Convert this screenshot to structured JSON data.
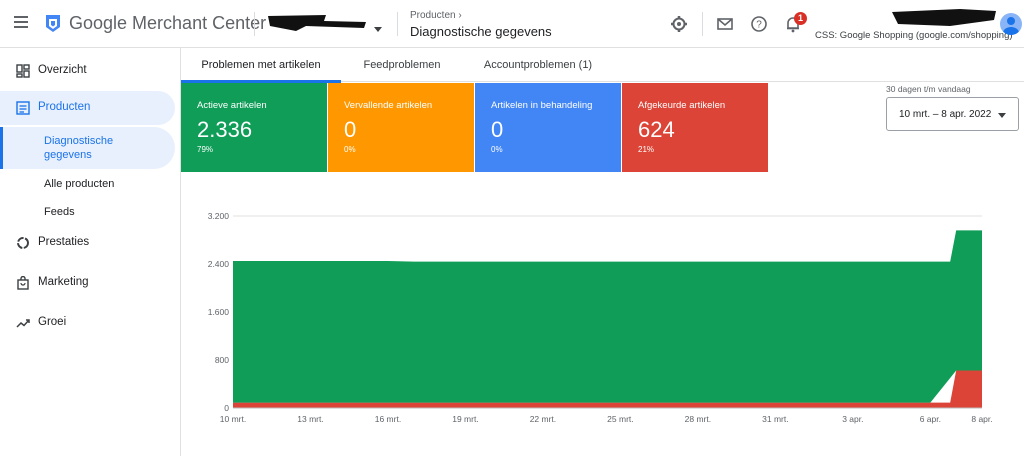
{
  "app": {
    "title": "Google Merchant Center",
    "brand_color": "#4285f4"
  },
  "breadcrumb": {
    "parent": "Producten",
    "current": "Diagnostische gegevens"
  },
  "header": {
    "css_label": "CSS: Google Shopping (google.com/shopping)",
    "notification_count": "1"
  },
  "sidebar": {
    "items": [
      {
        "label": "Overzicht",
        "icon": "dashboard-icon"
      },
      {
        "label": "Producten",
        "icon": "list-icon"
      },
      {
        "label": "Prestaties",
        "icon": "donut-icon"
      },
      {
        "label": "Marketing",
        "icon": "bag-icon"
      },
      {
        "label": "Groei",
        "icon": "trending-icon"
      }
    ],
    "sub_items": [
      {
        "label_line1": "Diagnostische",
        "label_line2": "gegevens"
      },
      {
        "label": "Alle producten"
      },
      {
        "label": "Feeds"
      }
    ]
  },
  "tabs": [
    {
      "label": "Problemen met artikelen"
    },
    {
      "label": "Feedproblemen"
    },
    {
      "label": "Accountproblemen (1)"
    }
  ],
  "stats": [
    {
      "label": "Actieve artikelen",
      "value": "2.336",
      "pct": "79%",
      "color": "#0f9d58"
    },
    {
      "label": "Vervallende artikelen",
      "value": "0",
      "pct": "0%",
      "color": "#ff9800"
    },
    {
      "label": "Artikelen in behandeling",
      "value": "0",
      "pct": "0%",
      "color": "#4285f4"
    },
    {
      "label": "Afgekeurde artikelen",
      "value": "624",
      "pct": "21%",
      "color": "#db4437"
    }
  ],
  "date_range": {
    "caption": "30 dagen t/m vandaag",
    "value": "10 mrt. – 8 apr. 2022"
  },
  "chart_data": {
    "type": "area",
    "stacked": true,
    "x": [
      "10 mrt.",
      "11 mrt.",
      "12 mrt.",
      "13 mrt.",
      "14 mrt.",
      "15 mrt.",
      "16 mrt.",
      "17 mrt.",
      "18 mrt.",
      "19 mrt.",
      "20 mrt.",
      "21 mrt.",
      "22 mrt.",
      "23 mrt.",
      "24 mrt.",
      "25 mrt.",
      "26 mrt.",
      "27 mrt.",
      "28 mrt.",
      "29 mrt.",
      "30 mrt.",
      "31 mrt.",
      "1 apr.",
      "2 apr.",
      "3 apr.",
      "4 apr.",
      "5 apr.",
      "6 apr.",
      "7 apr.",
      "8 apr."
    ],
    "x_tick_labels": [
      "10 mrt.",
      "13 mrt.",
      "16 mrt.",
      "19 mrt.",
      "22 mrt.",
      "25 mrt.",
      "28 mrt.",
      "31 mrt.",
      "3 apr.",
      "6 apr.",
      "8 apr."
    ],
    "y_ticks": [
      0,
      800,
      1600,
      2400,
      3200
    ],
    "y_tick_labels": [
      "0",
      "800",
      "1.600",
      "2.400",
      "3.200"
    ],
    "ylim": [
      0,
      3200
    ],
    "series": [
      {
        "name": "Afgekeurde artikelen",
        "color": "#db4437",
        "values": [
          90,
          90,
          90,
          90,
          90,
          90,
          90,
          90,
          90,
          90,
          90,
          90,
          90,
          90,
          90,
          90,
          90,
          90,
          90,
          90,
          90,
          90,
          90,
          90,
          90,
          90,
          90,
          90,
          624,
          624
        ]
      },
      {
        "name": "Actieve artikelen",
        "color": "#0f9d58",
        "values": [
          2360,
          2360,
          2360,
          2360,
          2360,
          2360,
          2360,
          2350,
          2350,
          2350,
          2350,
          2350,
          2350,
          2350,
          2350,
          2350,
          2350,
          2350,
          2350,
          2350,
          2350,
          2350,
          2350,
          2350,
          2350,
          2350,
          2350,
          2350,
          2336,
          2336
        ]
      }
    ],
    "grid": true
  }
}
